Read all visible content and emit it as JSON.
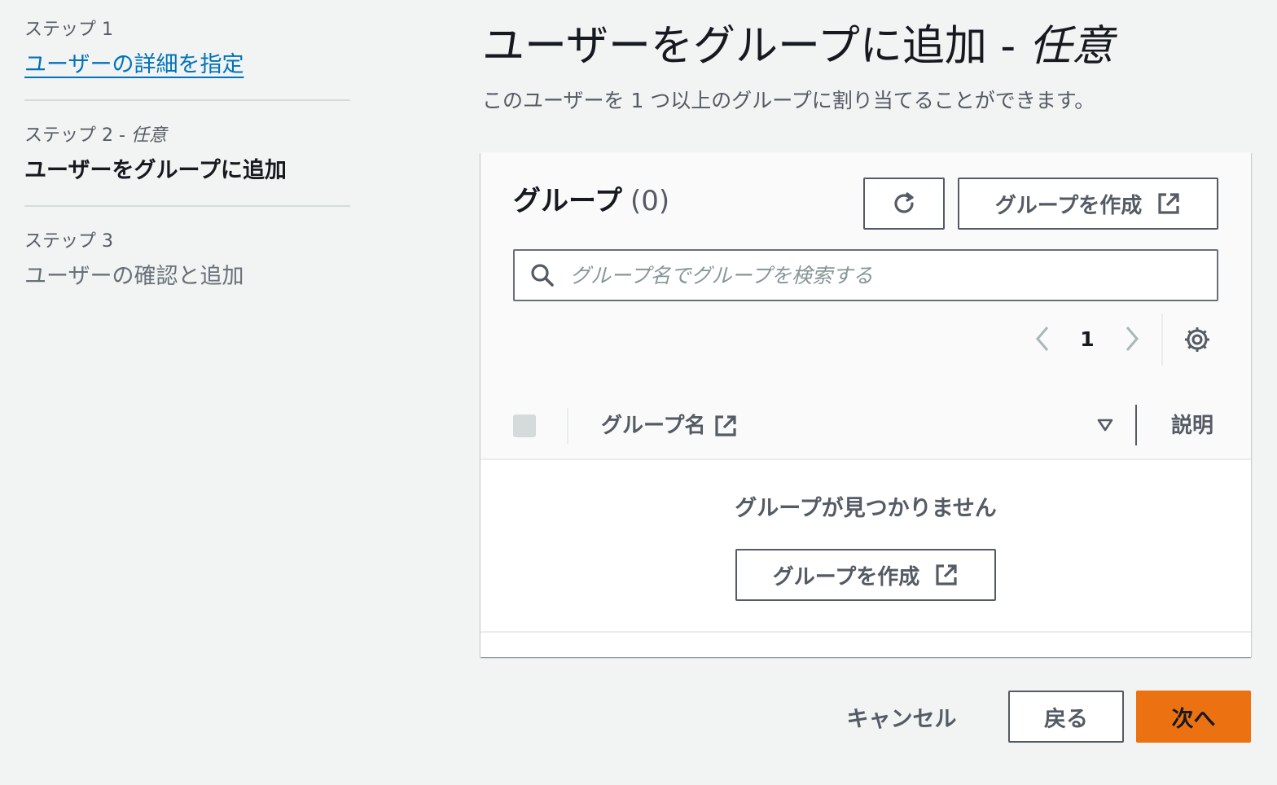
{
  "steps": [
    {
      "number": "ステップ 1",
      "title": "ユーザーの詳細を指定"
    },
    {
      "number": "ステップ 2 - ",
      "number_optional": "任意",
      "title": "ユーザーをグループに追加"
    },
    {
      "number": "ステップ 3",
      "title": "ユーザーの確認と追加"
    }
  ],
  "header": {
    "title": "ユーザーをグループに追加 - ",
    "title_optional": "任意",
    "description": "このユーザーを 1 つ以上のグループに割り当てることができます。"
  },
  "groups": {
    "title": "グループ",
    "count": "(0)",
    "create_button": "グループを作成",
    "search_placeholder": "グループ名でグループを検索する",
    "page": "1",
    "columns": {
      "name": "グループ名",
      "description": "説明"
    },
    "empty_text": "グループが見つかりません",
    "empty_create_button": "グループを作成"
  },
  "footer": {
    "cancel": "キャンセル",
    "back": "戻る",
    "next": "次へ"
  },
  "colors": {
    "link": "#0073bb",
    "primary": "#ec7211",
    "background": "#f2f3f3"
  }
}
